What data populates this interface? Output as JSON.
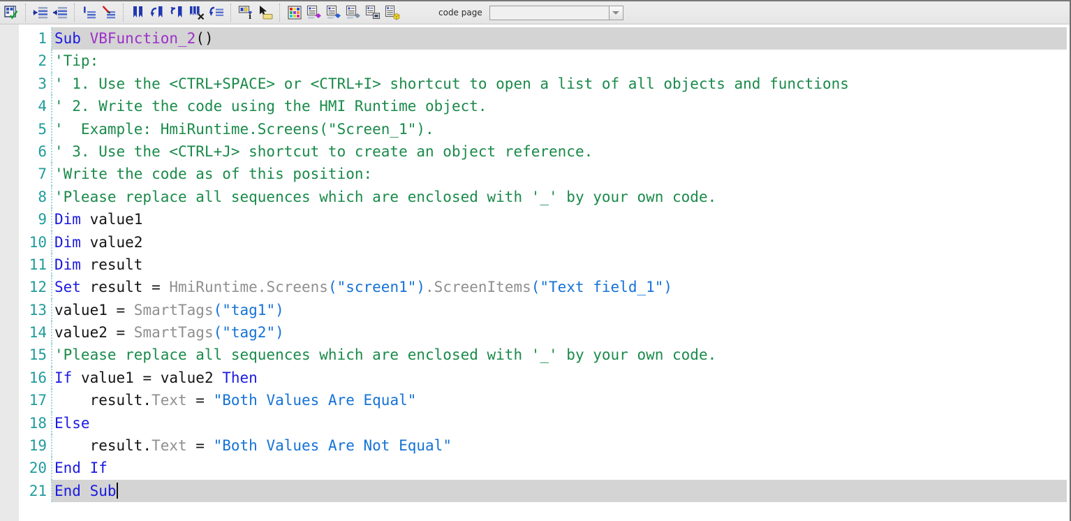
{
  "toolbar": {
    "groups": [
      {
        "name": "check",
        "buttons": [
          {
            "icon": "syntax-check-icon",
            "label": "Check syntax"
          }
        ]
      },
      {
        "name": "indent",
        "buttons": [
          {
            "icon": "increase-indent-icon",
            "label": "Increase indent"
          },
          {
            "icon": "decrease-indent-icon",
            "label": "Decrease indent"
          }
        ]
      },
      {
        "name": "comment",
        "buttons": [
          {
            "icon": "comment-block-icon",
            "label": "Comment block"
          },
          {
            "icon": "uncomment-block-icon",
            "label": "Uncomment block"
          }
        ]
      },
      {
        "name": "bookmark",
        "buttons": [
          {
            "icon": "toggle-bookmark-icon",
            "label": "Toggle bookmark"
          },
          {
            "icon": "previous-bookmark-icon",
            "label": "Previous bookmark"
          },
          {
            "icon": "next-bookmark-icon",
            "label": "Next bookmark"
          },
          {
            "icon": "clear-all-bookmarks-icon",
            "label": "Clear all bookmarks"
          },
          {
            "icon": "goto-bookmark-icon",
            "label": "Go to bookmark"
          }
        ]
      },
      {
        "name": "navigate",
        "buttons": [
          {
            "icon": "object-info-icon",
            "label": "Object information"
          },
          {
            "icon": "select-object-icon",
            "label": "Select object"
          }
        ]
      },
      {
        "name": "insert",
        "buttons": [
          {
            "icon": "color-palette-icon",
            "label": "Insert color"
          },
          {
            "icon": "insert-tag-icon",
            "label": "Insert tag"
          },
          {
            "icon": "insert-screen-icon",
            "label": "Insert screen"
          },
          {
            "icon": "insert-screen-item-icon",
            "label": "Insert screen item"
          },
          {
            "icon": "insert-list-icon",
            "label": "Insert list"
          },
          {
            "icon": "insert-object-icon",
            "label": "Insert object"
          }
        ]
      }
    ],
    "code_page": {
      "label": "code page",
      "value": "",
      "placeholder": ""
    }
  },
  "editor": {
    "current_line": 21,
    "caret_line": 21,
    "lines": [
      {
        "n": "1",
        "current": true,
        "tokens": [
          {
            "t": "kw",
            "s": "Sub"
          },
          {
            "t": "plain",
            "s": " "
          },
          {
            "t": "func",
            "s": "VBFunction_2"
          },
          {
            "t": "plain",
            "s": "()"
          }
        ]
      },
      {
        "n": "2",
        "current": false,
        "tokens": [
          {
            "t": "comment",
            "s": "'Tip:"
          }
        ]
      },
      {
        "n": "3",
        "current": false,
        "tokens": [
          {
            "t": "comment",
            "s": "' 1. Use the <CTRL+SPACE> or <CTRL+I> shortcut to open a list of all objects and functions"
          }
        ]
      },
      {
        "n": "4",
        "current": false,
        "tokens": [
          {
            "t": "comment",
            "s": "' 2. Write the code using the HMI Runtime object."
          }
        ]
      },
      {
        "n": "5",
        "current": false,
        "tokens": [
          {
            "t": "comment",
            "s": "'  Example: HmiRuntime.Screens(\"Screen_1\")."
          }
        ]
      },
      {
        "n": "6",
        "current": false,
        "tokens": [
          {
            "t": "comment",
            "s": "' 3. Use the <CTRL+J> shortcut to create an object reference."
          }
        ]
      },
      {
        "n": "7",
        "current": false,
        "tokens": [
          {
            "t": "comment",
            "s": "'Write the code as of this position:"
          }
        ]
      },
      {
        "n": "8",
        "current": false,
        "tokens": [
          {
            "t": "comment",
            "s": "'Please replace all sequences which are enclosed with '_' by your own code."
          }
        ]
      },
      {
        "n": "9",
        "current": false,
        "tokens": [
          {
            "t": "kw",
            "s": "Dim"
          },
          {
            "t": "plain",
            "s": " value1"
          }
        ]
      },
      {
        "n": "10",
        "current": false,
        "tokens": [
          {
            "t": "kw",
            "s": "Dim"
          },
          {
            "t": "plain",
            "s": " value2"
          }
        ]
      },
      {
        "n": "11",
        "current": false,
        "tokens": [
          {
            "t": "kw",
            "s": "Dim"
          },
          {
            "t": "plain",
            "s": " result"
          }
        ]
      },
      {
        "n": "12",
        "current": false,
        "tokens": [
          {
            "t": "kw",
            "s": "Set"
          },
          {
            "t": "plain",
            "s": " result = "
          },
          {
            "t": "obj",
            "s": "HmiRuntime.Screens"
          },
          {
            "t": "str",
            "s": "(\"screen1\")"
          },
          {
            "t": "obj",
            "s": ".ScreenItems"
          },
          {
            "t": "str",
            "s": "(\"Text field_1\")"
          }
        ]
      },
      {
        "n": "13",
        "current": false,
        "tokens": [
          {
            "t": "plain",
            "s": "value1 = "
          },
          {
            "t": "obj",
            "s": "SmartTags"
          },
          {
            "t": "str",
            "s": "(\"tag1\")"
          }
        ]
      },
      {
        "n": "14",
        "current": false,
        "tokens": [
          {
            "t": "plain",
            "s": "value2 = "
          },
          {
            "t": "obj",
            "s": "SmartTags"
          },
          {
            "t": "str",
            "s": "(\"tag2\")"
          }
        ]
      },
      {
        "n": "15",
        "current": false,
        "tokens": [
          {
            "t": "comment",
            "s": "'Please replace all sequences which are enclosed with '_' by your own code."
          }
        ]
      },
      {
        "n": "16",
        "current": false,
        "tokens": [
          {
            "t": "kw",
            "s": "If"
          },
          {
            "t": "plain",
            "s": " value1 = value2 "
          },
          {
            "t": "kw",
            "s": "Then"
          }
        ]
      },
      {
        "n": "17",
        "current": false,
        "tokens": [
          {
            "t": "plain",
            "s": "    result."
          },
          {
            "t": "obj",
            "s": "Text"
          },
          {
            "t": "plain",
            "s": " = "
          },
          {
            "t": "str",
            "s": "\"Both Values Are Equal\""
          }
        ]
      },
      {
        "n": "18",
        "current": false,
        "tokens": [
          {
            "t": "kw",
            "s": "Else"
          }
        ]
      },
      {
        "n": "19",
        "current": false,
        "tokens": [
          {
            "t": "plain",
            "s": "    result."
          },
          {
            "t": "obj",
            "s": "Text"
          },
          {
            "t": "plain",
            "s": " = "
          },
          {
            "t": "str",
            "s": "\"Both Values Are Not Equal\""
          }
        ]
      },
      {
        "n": "20",
        "current": false,
        "tokens": [
          {
            "t": "kw",
            "s": "End"
          },
          {
            "t": "plain",
            "s": " "
          },
          {
            "t": "kw",
            "s": "If"
          }
        ]
      },
      {
        "n": "21",
        "current": true,
        "caret": true,
        "tokens": [
          {
            "t": "kw",
            "s": "End Sub"
          }
        ]
      }
    ]
  },
  "colors": {
    "keyword": "#1a1ae0",
    "comment": "#1a8a4a",
    "function_name": "#9b30c8",
    "builtin_object": "#8f8f8f",
    "string": "#1572d6",
    "plain_text": "#141414",
    "line_number": "#1f9c9c",
    "current_line_background": "#d4d4d4",
    "toolbar_background": "#eaeaea",
    "gutter_strip": "#e9e9e9"
  }
}
